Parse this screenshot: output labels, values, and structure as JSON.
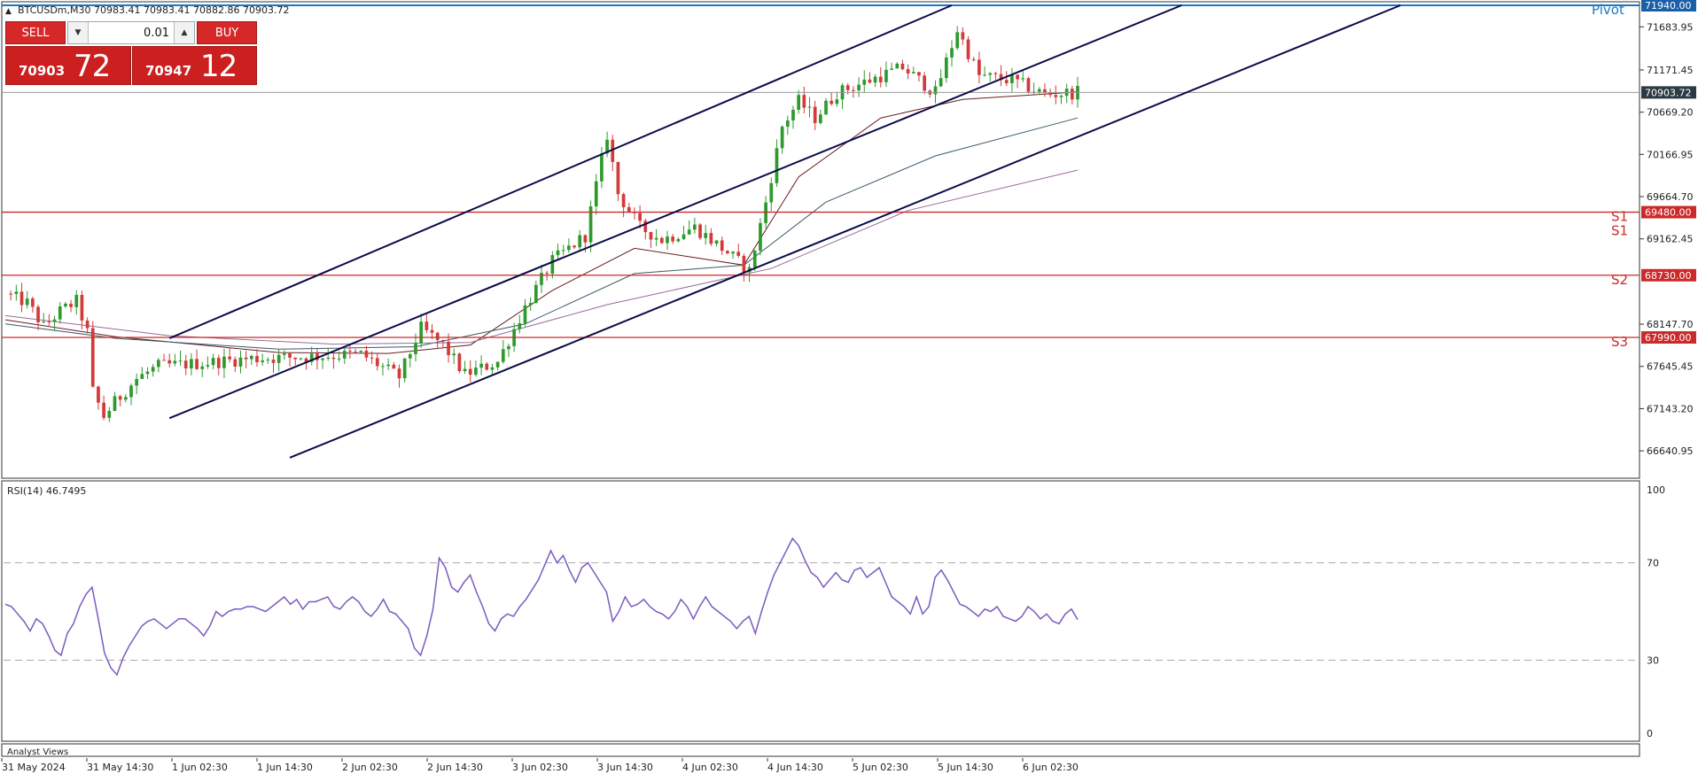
{
  "header": {
    "symbol_line": "BTCUSDm,M30  70983.41 70983.41 70882.86 70903.72"
  },
  "trade_panel": {
    "sell_label": "SELL",
    "buy_label": "BUY",
    "lot_value": "0.01",
    "sell_price_main": "70903",
    "sell_price_big": "72",
    "buy_price_main": "70947",
    "buy_price_big": "12"
  },
  "rsi_panel": {
    "label": "RSI(14) 46.7495"
  },
  "footer": {
    "analyst_label": "Analyst Views"
  },
  "colors": {
    "bull": "#2e9a2e",
    "bear": "#d33a3a",
    "channel": "#0a0a4a",
    "level": "#cc2a2a",
    "pivot": "#1a78c8",
    "rsi": "#7a5bbf",
    "ma_fast": "#6b1c1c",
    "ma_mid": "#3a5a6a",
    "ma_slow": "#9a6a9a"
  },
  "chart_data": [
    {
      "type": "candlestick",
      "symbol": "BTCUSDm",
      "timeframe": "M30",
      "ylim": [
        66400,
        71940
      ],
      "y_ticks": [
        "71683.95",
        "71171.45",
        "70669.20",
        "70166.95",
        "69664.70",
        "69162.45",
        "68147.70",
        "67645.45",
        "67143.20",
        "66640.95"
      ],
      "x_ticks": [
        "31 May 2024",
        "31 May 14:30",
        "1 Jun 02:30",
        "1 Jun 14:30",
        "2 Jun 02:30",
        "2 Jun 14:30",
        "3 Jun 02:30",
        "3 Jun 14:30",
        "4 Jun 02:30",
        "4 Jun 14:30",
        "5 Jun 02:30",
        "5 Jun 14:30",
        "6 Jun 02:30"
      ],
      "current_price": 70903.72,
      "current_price_label": "70903.72",
      "levels": [
        {
          "name": "Pivot",
          "price": 71940.0,
          "price_label": "71940.00"
        },
        {
          "name": "S1",
          "price": 69480.0,
          "price_label": "69480.00"
        },
        {
          "name": "S1",
          "price": 69480.0,
          "price_label": "69480.00"
        },
        {
          "name": "S2",
          "price": 68730.0,
          "price_label": "68730.00"
        },
        {
          "name": "S3",
          "price": 67990.0,
          "price_label": "67990.00"
        }
      ],
      "channel_lines": [
        {
          "start": [
            30,
            67980
          ],
          "end": [
            173,
            71940
          ]
        },
        {
          "start": [
            30,
            67030
          ],
          "end": [
            215,
            71940
          ]
        },
        {
          "start": [
            52,
            66560
          ],
          "end": [
            255,
            71940
          ]
        }
      ],
      "ohlc_close_path": [
        [
          0,
          68510
        ],
        [
          4,
          68400
        ],
        [
          7,
          68120
        ],
        [
          10,
          68300
        ],
        [
          13,
          68420
        ],
        [
          15,
          68050
        ],
        [
          16,
          67350
        ],
        [
          18,
          67050
        ],
        [
          20,
          67220
        ],
        [
          24,
          67500
        ],
        [
          28,
          67650
        ],
        [
          35,
          67680
        ],
        [
          45,
          67740
        ],
        [
          55,
          67760
        ],
        [
          65,
          67790
        ],
        [
          72,
          67520
        ],
        [
          76,
          68100
        ],
        [
          80,
          67900
        ],
        [
          84,
          67550
        ],
        [
          90,
          67700
        ],
        [
          95,
          68350
        ],
        [
          100,
          68900
        ],
        [
          106,
          69200
        ],
        [
          110,
          70400
        ],
        [
          112,
          69700
        ],
        [
          116,
          69300
        ],
        [
          120,
          69150
        ],
        [
          126,
          69300
        ],
        [
          132,
          69000
        ],
        [
          136,
          68780
        ],
        [
          139,
          69600
        ],
        [
          142,
          70500
        ],
        [
          145,
          70800
        ],
        [
          148,
          70600
        ],
        [
          152,
          70900
        ],
        [
          158,
          71050
        ],
        [
          164,
          71200
        ],
        [
          170,
          70900
        ],
        [
          174,
          71650
        ],
        [
          178,
          71100
        ],
        [
          184,
          71050
        ],
        [
          190,
          70880
        ],
        [
          196,
          70903
        ]
      ],
      "ma_paths": [
        {
          "name": "ma_fast",
          "points": [
            [
              0,
              68200
            ],
            [
              20,
              68000
            ],
            [
              50,
              67810
            ],
            [
              70,
              67800
            ],
            [
              85,
              67900
            ],
            [
              100,
              68550
            ],
            [
              115,
              69050
            ],
            [
              135,
              68850
            ],
            [
              145,
              69900
            ],
            [
              160,
              70600
            ],
            [
              175,
              70820
            ],
            [
              196,
              70910
            ]
          ]
        },
        {
          "name": "ma_mid",
          "points": [
            [
              0,
              68150
            ],
            [
              20,
              67980
            ],
            [
              50,
              67850
            ],
            [
              75,
              67880
            ],
            [
              95,
              68150
            ],
            [
              115,
              68750
            ],
            [
              135,
              68850
            ],
            [
              150,
              69600
            ],
            [
              170,
              70150
            ],
            [
              196,
              70600
            ]
          ]
        },
        {
          "name": "ma_slow",
          "points": [
            [
              0,
              68250
            ],
            [
              30,
              68010
            ],
            [
              60,
              67910
            ],
            [
              85,
              67930
            ],
            [
              110,
              68380
            ],
            [
              140,
              68810
            ],
            [
              165,
              69500
            ],
            [
              196,
              69980
            ]
          ]
        }
      ]
    },
    {
      "type": "line",
      "title": "RSI(14) 46.7495",
      "ylim": [
        0,
        100
      ],
      "y_ticks": [
        "100",
        "70",
        "30",
        "0"
      ],
      "levels": [
        70,
        30
      ],
      "values": [
        53,
        52,
        49,
        46,
        42,
        47,
        45,
        40,
        34,
        32,
        41,
        45,
        52,
        57,
        60,
        47,
        33,
        27,
        24,
        31,
        36,
        40,
        44,
        46,
        47,
        45,
        43,
        45,
        47,
        47,
        45,
        43,
        40,
        44,
        50,
        48,
        50,
        51,
        51,
        52,
        52,
        51,
        50,
        52,
        54,
        56,
        53,
        55,
        51,
        54,
        54,
        55,
        56,
        52,
        51,
        54,
        56,
        54,
        50,
        48,
        51,
        55,
        50,
        49,
        46,
        43,
        35,
        32,
        40,
        51,
        72,
        68,
        60,
        58,
        62,
        65,
        58,
        52,
        45,
        42,
        47,
        49,
        48,
        52,
        55,
        59,
        63,
        69,
        75,
        70,
        73,
        67,
        62,
        68,
        70,
        66,
        62,
        58,
        46,
        50,
        56,
        52,
        53,
        55,
        52,
        50,
        49,
        47,
        50,
        55,
        52,
        47,
        52,
        56,
        52,
        50,
        48,
        46,
        43,
        46,
        48,
        41,
        50,
        58,
        65,
        70,
        75,
        80,
        77,
        71,
        66,
        64,
        60,
        63,
        66,
        63,
        62,
        67,
        68,
        64,
        66,
        68,
        62,
        56,
        54,
        52,
        49,
        56,
        49,
        52,
        64,
        67,
        63,
        58,
        53,
        52,
        50,
        48,
        51,
        50,
        52,
        48,
        47,
        46,
        48,
        52,
        50,
        47,
        49,
        46,
        45,
        49,
        51,
        46.7
      ]
    }
  ]
}
